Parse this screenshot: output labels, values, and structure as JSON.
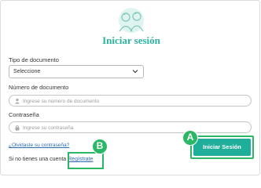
{
  "form": {
    "title": "Iniciar sesión",
    "doc_type_label": "Tipo de documento",
    "doc_type_selected": "Seleccione",
    "doc_number_label": "Número de documento",
    "doc_number_placeholder": "Ingrese su número de documento",
    "password_label": "Contraseña",
    "password_placeholder": "Ingrese su contraseña",
    "forgot_link": "¿Olvidaste su contraseña?",
    "register_prompt": "Si no tienes una cuenta",
    "register_link": "Regístrate",
    "submit_label": "Iniciar Sesión"
  },
  "markers": {
    "a": "A",
    "b": "B"
  },
  "colors": {
    "brand_teal": "#1fae9a",
    "title_teal": "#2bb39f",
    "highlight_green": "#2bb866",
    "link_blue": "#2b6cb0"
  },
  "icons": {
    "logo": "people-illustration-icon",
    "select_chevron": "chevron-down-icon",
    "doc_field": "person-icon",
    "password_field": "lock-icon"
  }
}
